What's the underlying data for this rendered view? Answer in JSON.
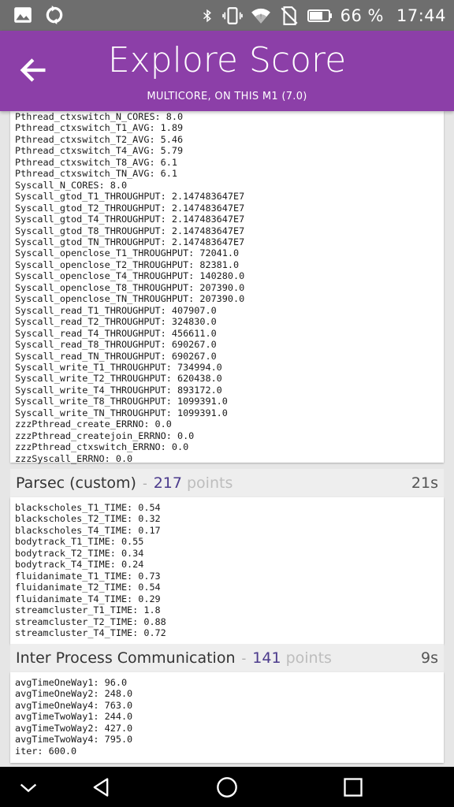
{
  "status_bar": {
    "battery_percent": "66 %",
    "time": "17:44",
    "icons": [
      "image-icon",
      "sync-icon",
      "bluetooth-icon",
      "vibrate-icon",
      "wifi-icon",
      "no-sim-icon",
      "battery-icon"
    ]
  },
  "header": {
    "title": "Explore Score",
    "subtitle": "MULTICORE, ON THIS M1 (7.0)",
    "back_icon": "back-arrow-icon",
    "color": "#8c3fa8"
  },
  "sections": [
    {
      "lines": [
        "Pthread_ctxswitch_N_CORES: 8.0",
        "Pthread_ctxswitch_T1_AVG: 1.89",
        "Pthread_ctxswitch_T2_AVG: 5.46",
        "Pthread_ctxswitch_T4_AVG: 5.79",
        "Pthread_ctxswitch_T8_AVG: 6.1",
        "Pthread_ctxswitch_TN_AVG: 6.1",
        "Syscall_N_CORES: 8.0",
        "Syscall_gtod_T1_THROUGHPUT: 2.147483647E7",
        "Syscall_gtod_T2_THROUGHPUT: 2.147483647E7",
        "Syscall_gtod_T4_THROUGHPUT: 2.147483647E7",
        "Syscall_gtod_T8_THROUGHPUT: 2.147483647E7",
        "Syscall_gtod_TN_THROUGHPUT: 2.147483647E7",
        "Syscall_openclose_T1_THROUGHPUT: 72041.0",
        "Syscall_openclose_T2_THROUGHPUT: 82381.0",
        "Syscall_openclose_T4_THROUGHPUT: 140280.0",
        "Syscall_openclose_T8_THROUGHPUT: 207390.0",
        "Syscall_openclose_TN_THROUGHPUT: 207390.0",
        "Syscall_read_T1_THROUGHPUT: 407907.0",
        "Syscall_read_T2_THROUGHPUT: 324830.0",
        "Syscall_read_T4_THROUGHPUT: 456611.0",
        "Syscall_read_T8_THROUGHPUT: 690267.0",
        "Syscall_read_TN_THROUGHPUT: 690267.0",
        "Syscall_write_T1_THROUGHPUT: 734994.0",
        "Syscall_write_T2_THROUGHPUT: 620438.0",
        "Syscall_write_T4_THROUGHPUT: 893172.0",
        "Syscall_write_T8_THROUGHPUT: 1099391.0",
        "Syscall_write_TN_THROUGHPUT: 1099391.0",
        "zzzPthread_create_ERRNO: 0.0",
        "zzzPthread_createjoin_ERRNO: 0.0",
        "zzzPthread_ctxswitch_ERRNO: 0.0",
        "zzzSyscall_ERRNO: 0.0"
      ]
    },
    {
      "name": "Parsec (custom)",
      "separator": "-",
      "score": "217",
      "unit": "points",
      "time": "21s",
      "lines": [
        "blackscholes_T1_TIME: 0.54",
        "blackscholes_T2_TIME: 0.32",
        "blackscholes_T4_TIME: 0.17",
        "bodytrack_T1_TIME: 0.55",
        "bodytrack_T2_TIME: 0.34",
        "bodytrack_T4_TIME: 0.24",
        "fluidanimate_T1_TIME: 0.73",
        "fluidanimate_T2_TIME: 0.54",
        "fluidanimate_T4_TIME: 0.29",
        "streamcluster_T1_TIME: 1.8",
        "streamcluster_T2_TIME: 0.88",
        "streamcluster_T4_TIME: 0.72"
      ]
    },
    {
      "name": "Inter Process Communication",
      "separator": "-",
      "score": "141",
      "unit": "points",
      "time": "9s",
      "lines": [
        "avgTimeOneWay1: 96.0",
        "avgTimeOneWay2: 248.0",
        "avgTimeOneWay4: 763.0",
        "avgTimeTwoWay1: 244.0",
        "avgTimeTwoWay2: 427.0",
        "avgTimeTwoWay4: 795.0",
        "iter: 600.0"
      ]
    }
  ],
  "nav_bar": {
    "icons": [
      "nav-down-icon",
      "nav-back-icon",
      "nav-home-icon",
      "nav-recents-icon"
    ]
  }
}
